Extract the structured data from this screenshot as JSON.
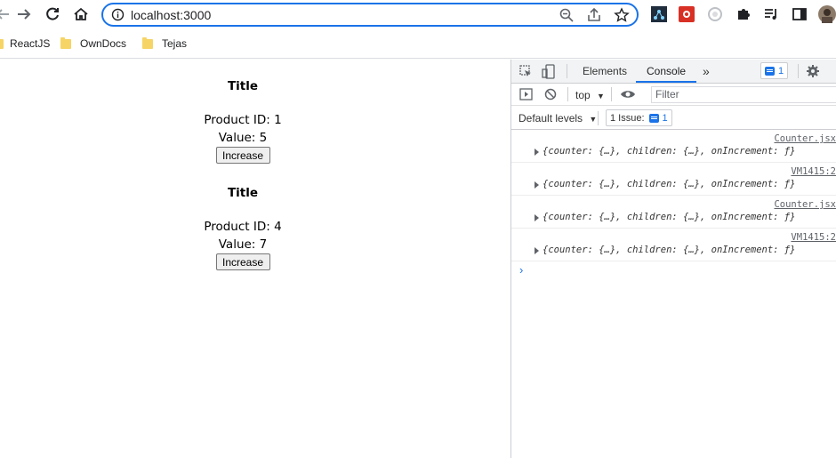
{
  "browser": {
    "url": "localhost:3000",
    "bookmarks": [
      {
        "label": "ReactJS",
        "icon": "react-icon"
      },
      {
        "label": "OwnDocs",
        "icon": "folder-icon"
      },
      {
        "label": "Tejas",
        "icon": "folder-icon"
      }
    ]
  },
  "page": {
    "cards": [
      {
        "title": "Title",
        "product_id": "Product ID: 1",
        "value": "Value: 5",
        "button": "Increase"
      },
      {
        "title": "Title",
        "product_id": "Product ID: 4",
        "value": "Value: 7",
        "button": "Increase"
      }
    ]
  },
  "devtools": {
    "tabs": {
      "elements": "Elements",
      "console": "Console"
    },
    "issues_badge": "1",
    "context": "top",
    "filter_placeholder": "Filter",
    "default_levels": "Default levels",
    "issue_button": "1 Issue:",
    "issue_count": "1",
    "logs": [
      {
        "source": "Counter.jsx",
        "text": "{counter: {…}, children: {…}, onIncrement: ƒ}"
      },
      {
        "source": "VM1415:2",
        "text": "{counter: {…}, children: {…}, onIncrement: ƒ}"
      },
      {
        "source": "Counter.jsx",
        "text": "{counter: {…}, children: {…}, onIncrement: ƒ}"
      },
      {
        "source": "VM1415:2",
        "text": "{counter: {…}, children: {…}, onIncrement: ƒ}"
      }
    ],
    "prompt": "›"
  },
  "colors": {
    "accent": "#1a73e8",
    "folder": "#f6d466"
  }
}
